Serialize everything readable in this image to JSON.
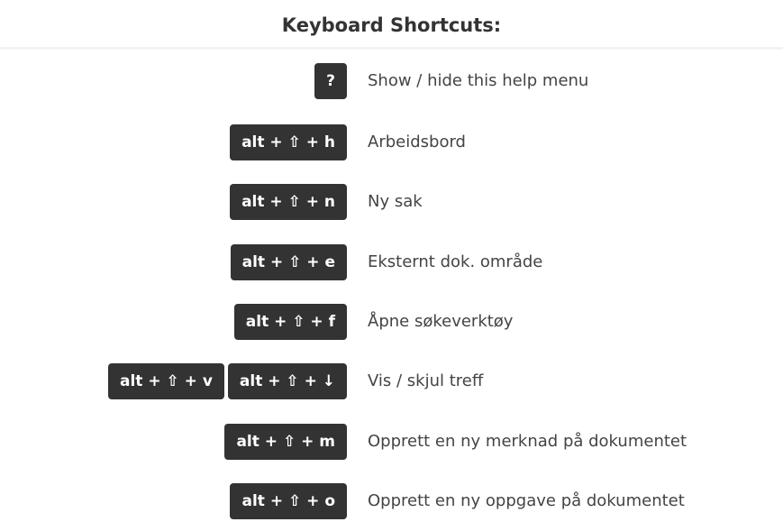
{
  "title": "Keyboard Shortcuts:",
  "shortcuts": [
    {
      "keys": [
        "?"
      ],
      "description": "Show / hide this help menu"
    },
    {
      "keys": [
        "alt + ⇧ + h"
      ],
      "description": "Arbeidsbord"
    },
    {
      "keys": [
        "alt + ⇧ + n"
      ],
      "description": "Ny sak"
    },
    {
      "keys": [
        "alt + ⇧ + e"
      ],
      "description": "Eksternt dok. område"
    },
    {
      "keys": [
        "alt + ⇧ + f"
      ],
      "description": "Åpne søkeverktøy"
    },
    {
      "keys": [
        "alt + ⇧ + v",
        "alt + ⇧ + ↓"
      ],
      "description": "Vis / skjul treff"
    },
    {
      "keys": [
        "alt + ⇧ + m"
      ],
      "description": "Opprett en ny merknad på dokumentet"
    },
    {
      "keys": [
        "alt + ⇧ + o"
      ],
      "description": "Opprett en ny oppgave på dokumentet"
    }
  ]
}
